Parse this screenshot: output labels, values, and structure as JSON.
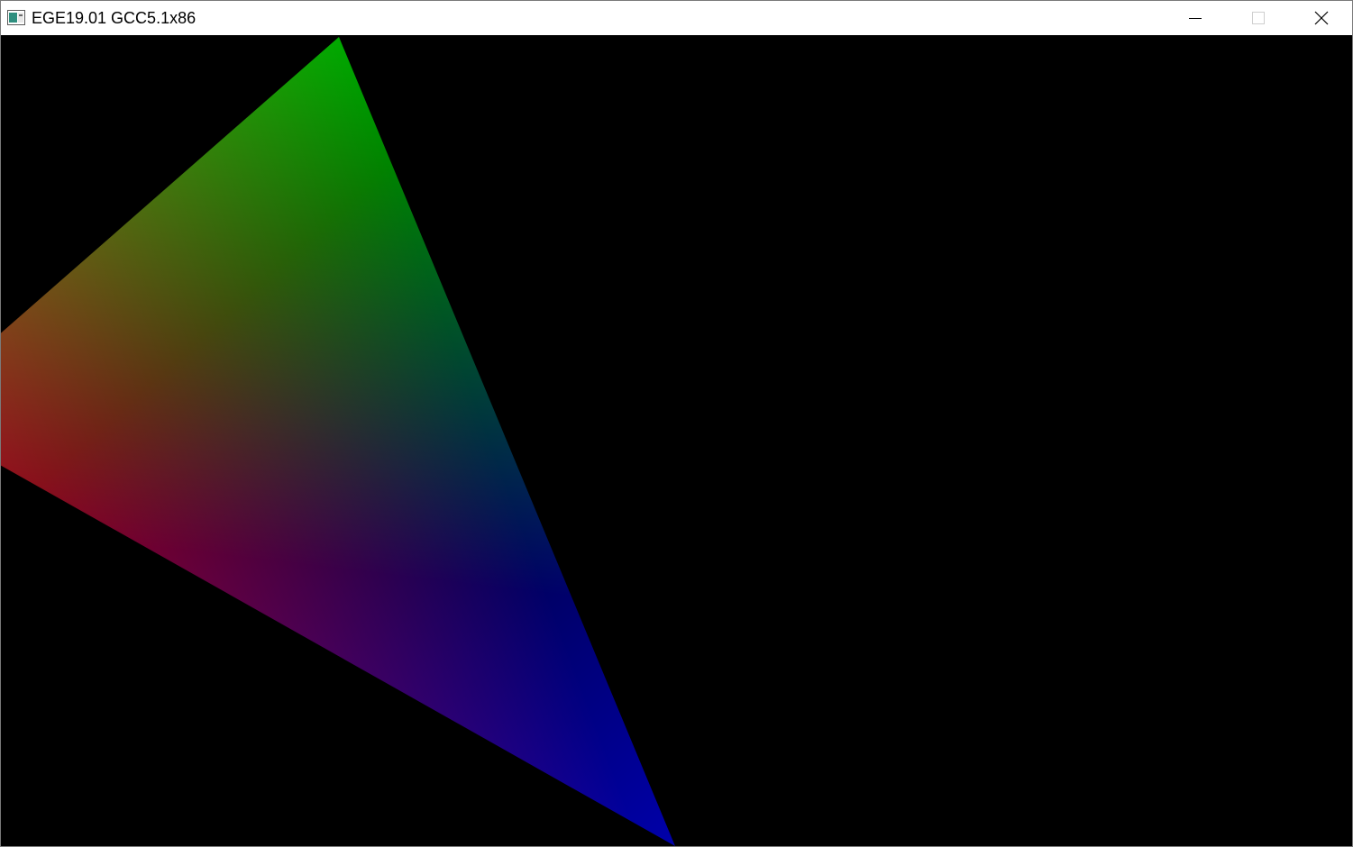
{
  "window": {
    "title": "EGE19.01 GCC5.1x86"
  },
  "icons": {
    "app": "app-window-icon",
    "minimize": "minimize-icon",
    "maximize": "maximize-icon",
    "close": "close-icon"
  },
  "canvas": {
    "background": "#000000",
    "triangle": {
      "vertex_colors": {
        "top": "#00aa00",
        "left": "#aa0022",
        "bottom": "#0000aa"
      }
    }
  }
}
